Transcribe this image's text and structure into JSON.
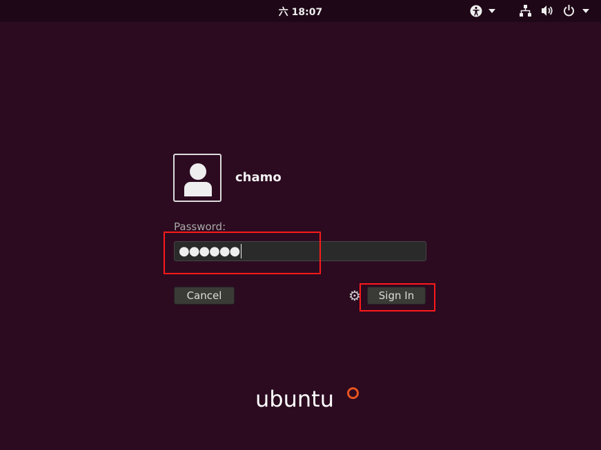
{
  "topbar": {
    "clock": "六 18:07",
    "icons": [
      "accessibility-icon",
      "network-icon",
      "volume-icon",
      "power-icon"
    ]
  },
  "login": {
    "username": "chamo",
    "password_label": "Password:",
    "password_value": "●●●●●●",
    "cancel_label": "Cancel",
    "signin_label": "Sign In"
  },
  "branding": {
    "logo_text": "ubuntu",
    "accent": "#e95420"
  },
  "colors": {
    "background": "#2c0b20",
    "highlight": "#ff1a1a"
  }
}
